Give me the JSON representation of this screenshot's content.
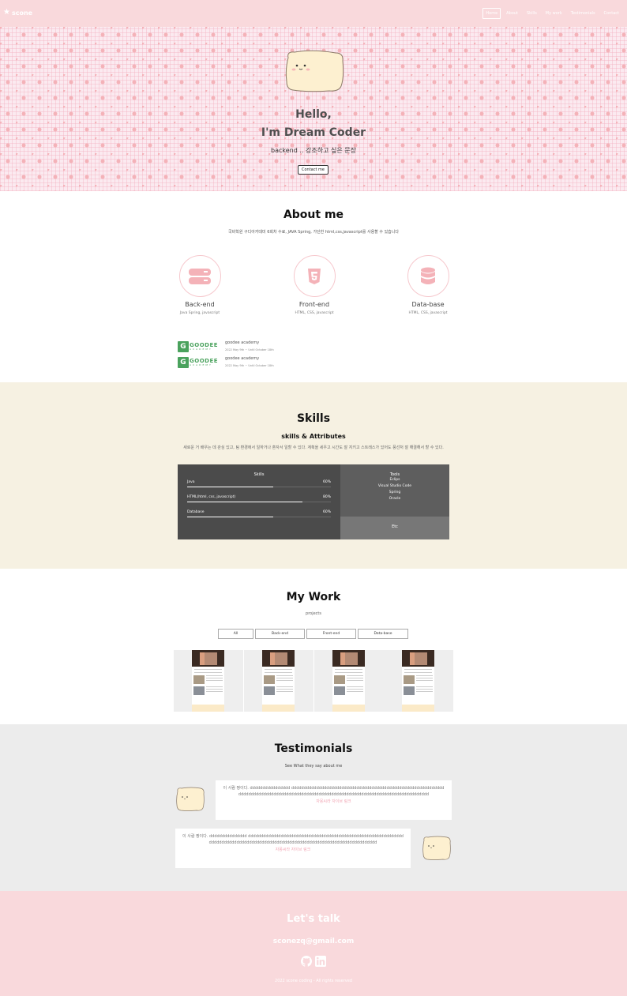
{
  "navbar": {
    "logo": "scone",
    "menu": [
      "Home",
      "About",
      "Skills",
      "My work",
      "Testimonials",
      "Contact"
    ]
  },
  "home": {
    "title_line1": "Hello,",
    "title_line2": "I'm Dream Coder",
    "description": "backend .. 강조하고 싶은 문장",
    "contact_button": "Contact me"
  },
  "about": {
    "title": "About me",
    "description": "국비학원 구디아카데미 6회차 수료, JAVA Spring, 가단한 html,css,javascript를 사용할 수 있습니다",
    "majors": [
      {
        "name": "Back-end",
        "description": "Java Spring, javascript",
        "icon": "server-icon"
      },
      {
        "name": "Front-end",
        "description": "HTML, CSS, javascript",
        "icon": "html5-icon"
      },
      {
        "name": "Data-base",
        "description": "HTML, CSS, javascript",
        "icon": "database-icon"
      }
    ],
    "jobs": [
      {
        "name": "goodee academy",
        "period": "2022 May 9th ~ Until October 18th",
        "logo_text": "GOODEE",
        "logo_sub": "ACADEMY"
      },
      {
        "name": "goodee academy",
        "period": "2022 May 9th ~ Until October 18th",
        "logo_text": "GOODEE",
        "logo_sub": "ACADEMY"
      }
    ]
  },
  "skills": {
    "title": "Skills",
    "subtitle": "skills & Attributes",
    "description": "새로운 거 배우는 데 관심 있고, 팀 환경에서 일하거나 혼자서 일할 수 있다. 계획을 세우고 시간도 잘 지키고 스트레스가 있어도 풍선처 잘 해결해서 할 수 있다.",
    "skills_header": "Skills",
    "items": [
      {
        "name": "Java",
        "percent": "60%",
        "level": 0.6
      },
      {
        "name": "HTML(html, css, javascript)",
        "percent": "80%",
        "level": 0.8
      },
      {
        "name": "Database",
        "percent": "60%",
        "level": 0.6
      }
    ],
    "tools_header": "Tools",
    "tools": [
      "Eclips",
      "Visual Studio Code",
      "Spring",
      "Oracle"
    ],
    "etc_header": "Etc"
  },
  "work": {
    "title": "My Work",
    "subtitle": "projects",
    "categories": [
      "All",
      "Back-end",
      "Front-end",
      "Data-base"
    ],
    "project_count": 4
  },
  "testimonials": {
    "title": "Testimonials",
    "subtitle": "See What they say about me",
    "items": [
      {
        "quote": "이 사람 짱이다. dddddddddddddddd ddddddddddddddddddddddddddddddddddddddddddddddddddddddddddddddddddddddddddddddddddddddddddddddddddddddddddddddddddddddddddddddddddddddddd",
        "author": "자몽씨라 자이브 링크"
      },
      {
        "quote": "이 사람 짱이다. ddddddddddddddd ddddddddddddddddddddddddddddddddddddddddddddddddddddddddddddddddddddddddddddddddddddddddddddddddddddddddddddddddddddddddddddddddd",
        "author": "자몽씨라 자이브 링크"
      }
    ]
  },
  "contact": {
    "title": "Let's talk",
    "email": "sconezq@gmail.com",
    "links": [
      "github-icon",
      "linkedin-icon"
    ],
    "rights": "2022 scone coding - All rights reserved"
  },
  "colors": {
    "navbar": "#f9d9dc",
    "skills_bg": "#f6f1e2",
    "testimonials_bg": "#ececec",
    "accent_pink": "#f1a7b5",
    "skills_box": "#4b4b4b",
    "tools_box": "#5e5e5e",
    "etc_box": "#777777"
  }
}
